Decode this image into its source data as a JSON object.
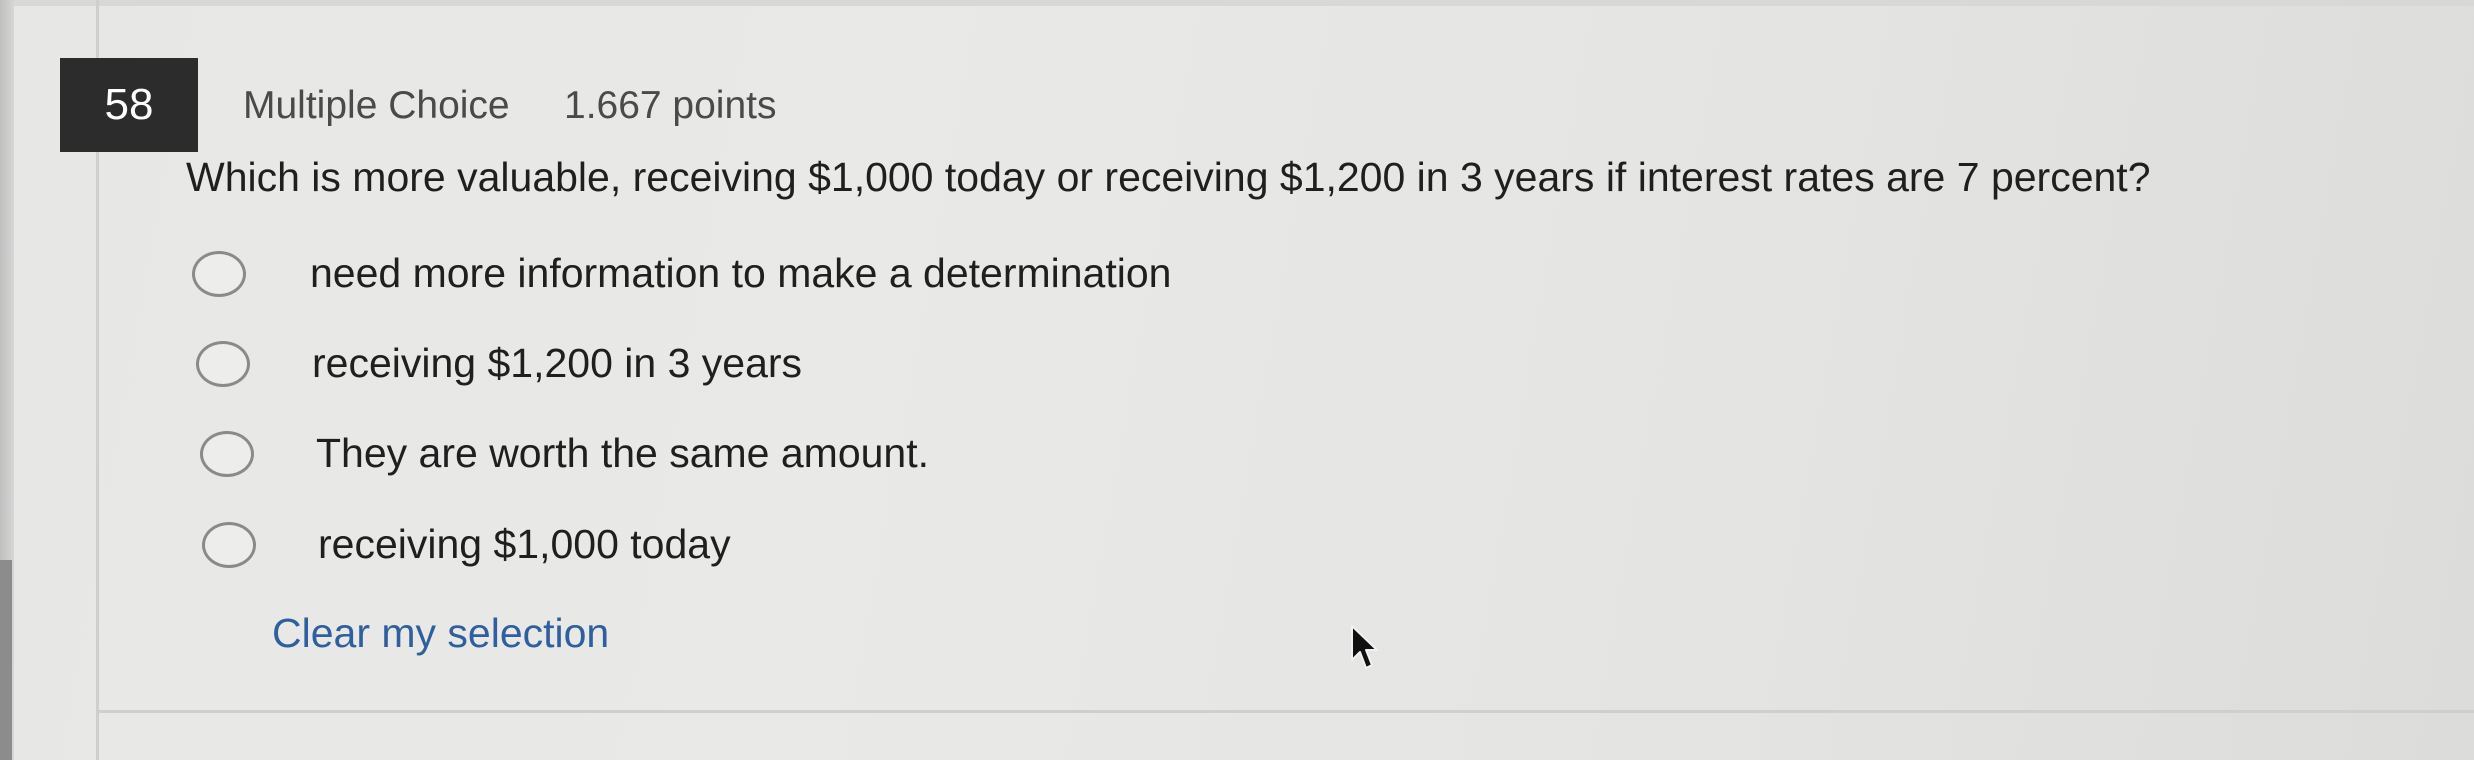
{
  "question": {
    "number": "58",
    "type": "Multiple Choice",
    "points": "1.667 points",
    "text": "Which is more valuable, receiving $1,000 today or receiving $1,200 in 3 years if interest rates are 7 percent?"
  },
  "options": [
    {
      "label": "need more information to make a determination",
      "selected": false
    },
    {
      "label": "receiving $1,200 in 3 years",
      "selected": false
    },
    {
      "label": "They are worth the same amount.",
      "selected": false
    },
    {
      "label": "receiving $1,000 today",
      "selected": false
    }
  ],
  "actions": {
    "clear_label": "Clear my selection"
  },
  "icons": {
    "cursor": "mouse-pointer-icon"
  },
  "colors": {
    "link": "#2f5f9e",
    "number_badge": "#2c2c2c"
  }
}
